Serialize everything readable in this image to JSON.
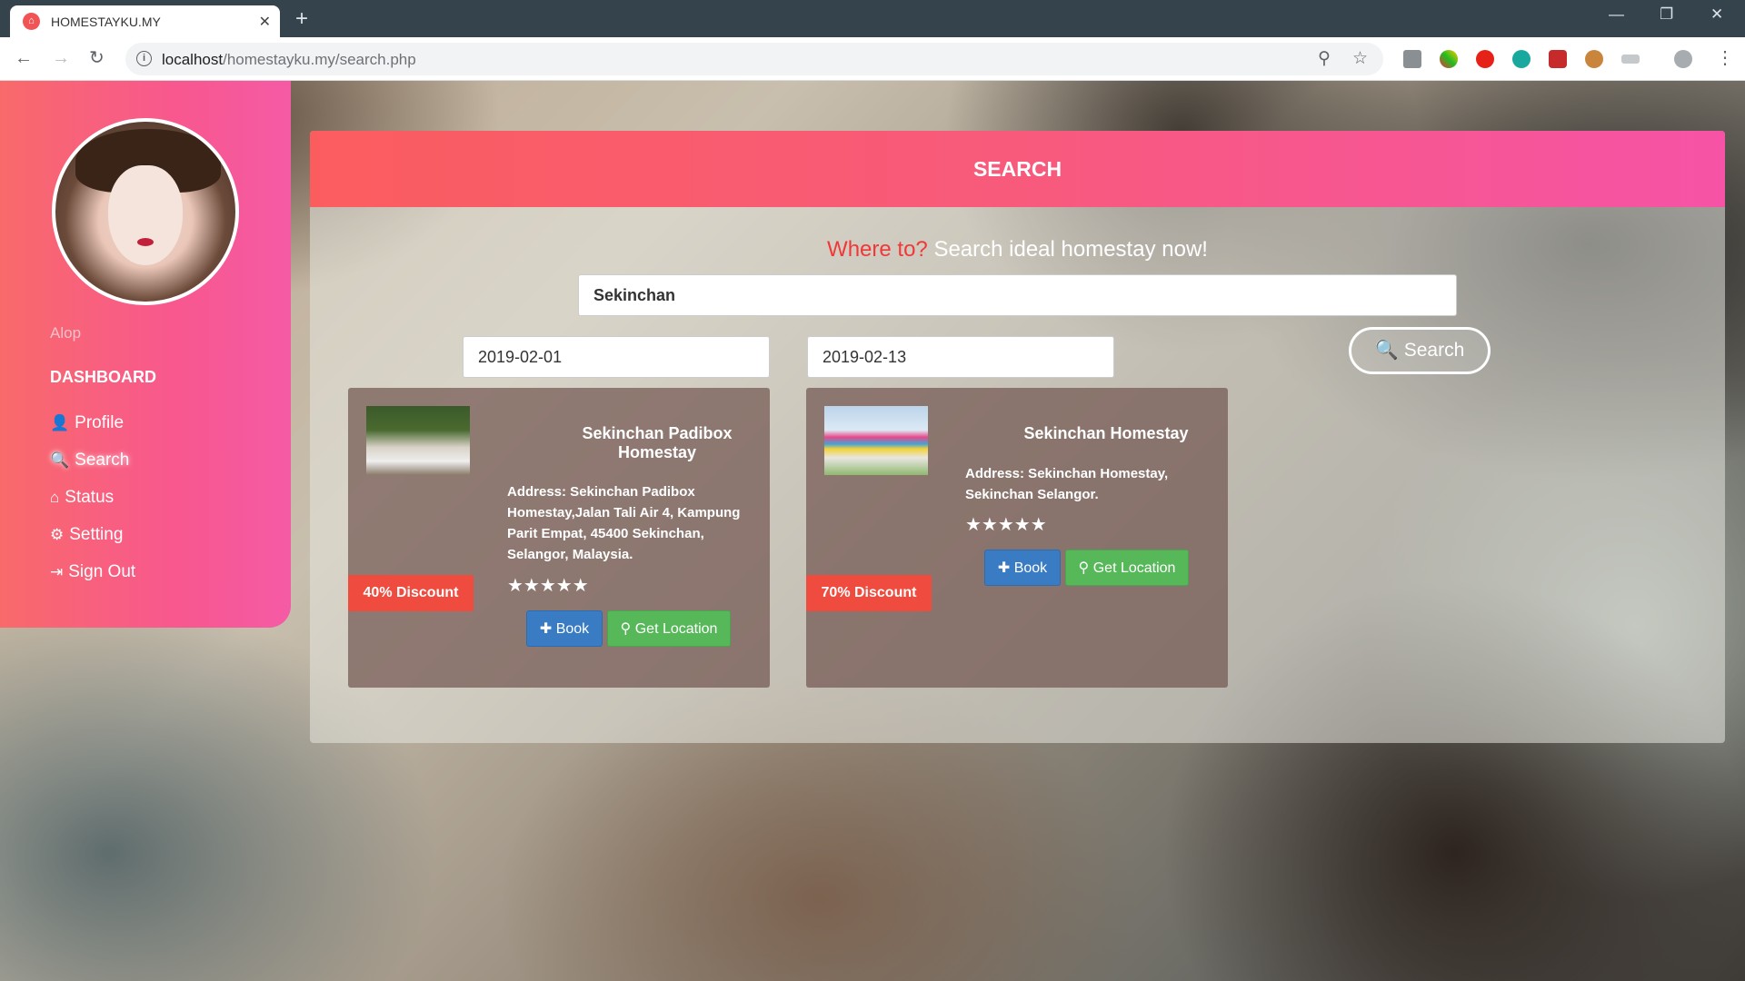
{
  "browser": {
    "tab_title": "HOMESTAYKU.MY",
    "tab_close": "✕",
    "new_tab": "+",
    "url_host": "localhost",
    "url_path": "/homestayku.my/search.php",
    "back": "←",
    "forward": "→",
    "reload": "↻",
    "minimize": "—",
    "restore": "❐",
    "close": "✕",
    "zoom": "⚲",
    "bookmark": "☆",
    "menu": "⋮",
    "info": "i",
    "favicon": "⌂"
  },
  "sidebar": {
    "user_name": "Alop",
    "menu_title": "DASHBOARD",
    "items": [
      {
        "icon": "user-icon",
        "glyph": "👤",
        "label": "Profile"
      },
      {
        "icon": "search-icon",
        "glyph": "🔍",
        "label": "Search"
      },
      {
        "icon": "home-icon",
        "glyph": "⌂",
        "label": "Status"
      },
      {
        "icon": "gear-icon",
        "glyph": "⚙",
        "label": "Setting"
      },
      {
        "icon": "sign-out-icon",
        "glyph": "⇥",
        "label": "Sign Out"
      }
    ],
    "active_item": "Search"
  },
  "panel": {
    "title": "SEARCH",
    "tagline_red": "Where to?",
    "tagline_white": "Search ideal homestay now!",
    "location_value": "Sekinchan",
    "checkin_value": "2019-02-01",
    "checkout_value": "2019-02-13",
    "search_button": "Search",
    "search_glyph": "🔍"
  },
  "results": [
    {
      "name": "Sekinchan Padibox Homestay",
      "address": "Address: Sekinchan Padibox Homestay,Jalan Tali Air 4, Kampung Parit Empat, 45400 Sekinchan, Selangor, Malaysia.",
      "stars": "★★★★★",
      "rating": 5,
      "discount": "40% Discount",
      "book_label": "Book",
      "location_label": "Get Location",
      "book_glyph": "✚",
      "location_glyph": "⚲"
    },
    {
      "name": "Sekinchan Homestay",
      "address": "Address: Sekinchan Homestay, Sekinchan Selangor.",
      "stars": "★★★★★",
      "rating": 5,
      "discount": "70% Discount",
      "book_label": "Book",
      "location_label": "Get Location",
      "book_glyph": "✚",
      "location_glyph": "⚲"
    }
  ],
  "colors": {
    "accent_red": "#f03838",
    "header_pink": "#f653a6",
    "discount_red": "#ef4b3f",
    "book_blue": "#3a7cc4",
    "location_green": "#57b85a"
  }
}
